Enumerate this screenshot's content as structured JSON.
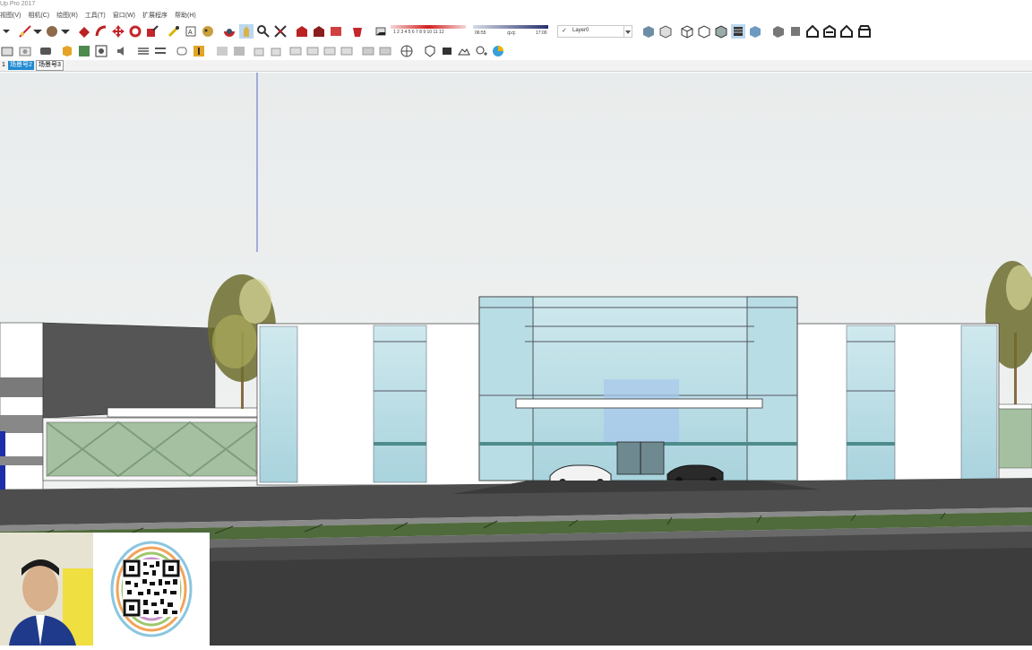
{
  "app": {
    "title": "Up Pro 2017"
  },
  "menu": [
    "视图(V)",
    "相机(C)",
    "绘图(R)",
    "工具(T)",
    "窗口(W)",
    "扩展程序",
    "帮助(H)"
  ],
  "toolbar": {
    "shadow_months": "1 2 3 4 5 6 7 8 9 10 11 12",
    "time_start": "06:55",
    "time_mid": "中午",
    "time_end": "17:00",
    "layer_check": "✓",
    "layer_name": "Layer0"
  },
  "scenes": {
    "tabs": [
      {
        "label": "1",
        "active": false
      },
      {
        "label": "场景号2",
        "active": true
      },
      {
        "label": "场景号3",
        "active": false
      }
    ]
  },
  "colors": {
    "accent": "#1f8ad2",
    "sky_top": "#e9ecec",
    "sky_bottom": "#f3f4f4",
    "glass": "#bfe3ea",
    "road": "#4a4a4a",
    "grass": "#4f6a3b"
  }
}
